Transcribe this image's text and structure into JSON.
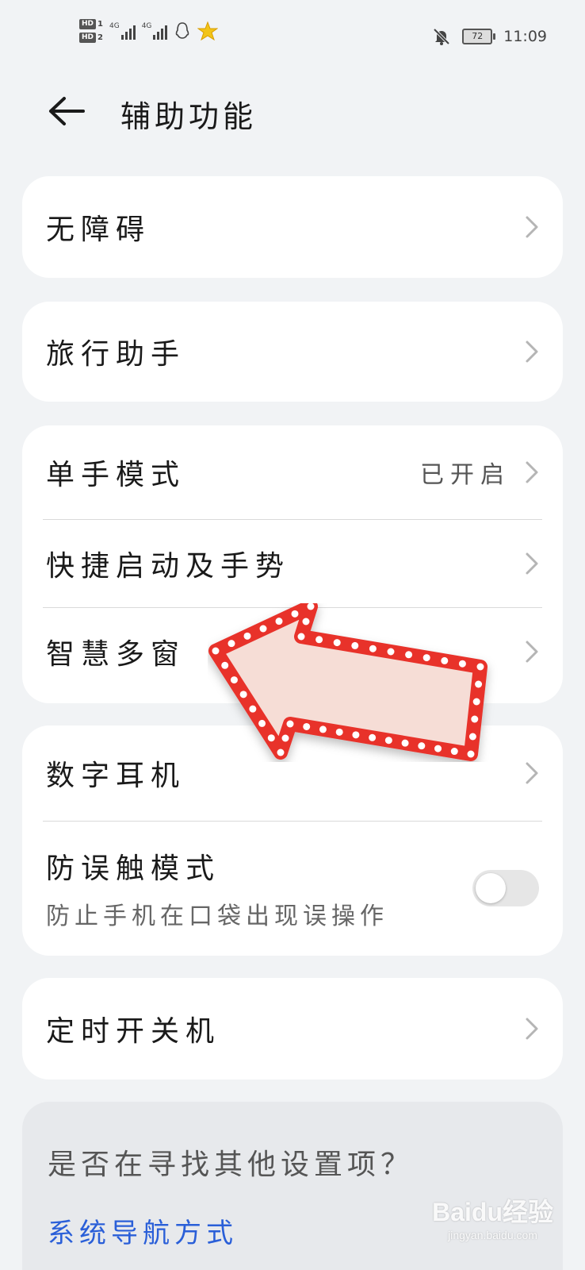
{
  "status_bar": {
    "hd1": "HD",
    "hd1_num": "1",
    "hd2": "HD",
    "hd2_num": "2",
    "net1": "4G",
    "net2": "4G",
    "battery": "72",
    "time": "11:09"
  },
  "header": {
    "title": "辅助功能"
  },
  "cards": {
    "accessibility": {
      "label": "无障碍"
    },
    "travel": {
      "label": "旅行助手"
    },
    "group3": {
      "one_hand": {
        "label": "单手模式",
        "value": "已开启"
      },
      "quick_launch": {
        "label": "快捷启动及手势"
      },
      "multi_window": {
        "label": "智慧多窗"
      }
    },
    "group4": {
      "digital_headset": {
        "label": "数字耳机"
      },
      "anti_mistouch": {
        "label": "防误触模式",
        "subtitle": "防止手机在口袋出现误操作",
        "enabled": false
      }
    },
    "scheduled_power": {
      "label": "定时开关机"
    }
  },
  "suggestion": {
    "question": "是否在寻找其他设置项？",
    "link": "系统导航方式"
  },
  "watermark": {
    "line1": "Baidu经验",
    "line2": "jingyan.baidu.com"
  },
  "colors": {
    "background": "#f1f3f5",
    "card": "#ffffff",
    "link": "#2a5fd8",
    "annotation_arrow": "#e8312c"
  },
  "icons": {
    "back": "arrow-left-icon",
    "chevron": "chevron-right-icon",
    "mute": "bell-off-icon",
    "qq": "qq-icon",
    "star": "star-badge-icon"
  }
}
